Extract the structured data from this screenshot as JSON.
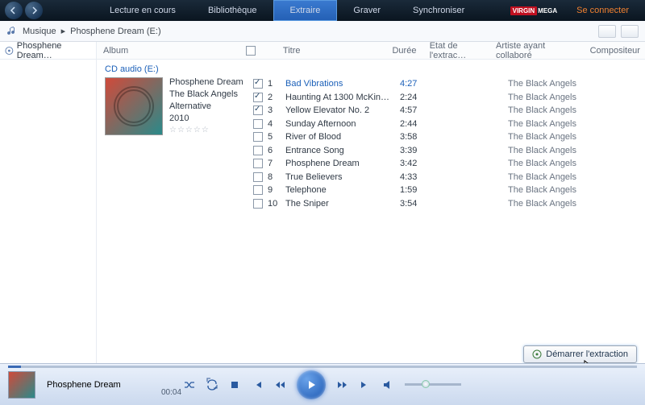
{
  "topbar": {
    "tabs": [
      "Lecture en cours",
      "Bibliothèque",
      "Extraire",
      "Graver",
      "Synchroniser"
    ],
    "active_tab_index": 2,
    "shop": "VIRGINMEGA",
    "login": "Se connecter"
  },
  "breadcrumb": {
    "items": [
      "Musique",
      "Phosphene Dream (E:)"
    ]
  },
  "sidebar": {
    "label": "Phosphene Dream…"
  },
  "columns": {
    "album": "Album",
    "title": "Titre",
    "duration": "Durée",
    "status": "État de l'extrac…",
    "artist": "Artiste ayant collaboré",
    "composer": "Compositeur"
  },
  "cd_label": "CD audio (E:)",
  "album": {
    "name": "Phosphene Dream",
    "artist": "The Black Angels",
    "genre": "Alternative",
    "year": "2010"
  },
  "tracks": [
    {
      "n": "1",
      "title": "Bad Vibrations",
      "dur": "4:27",
      "artist": "The Black Angels",
      "checked": true,
      "playing": true
    },
    {
      "n": "2",
      "title": "Haunting At 1300 McKin…",
      "dur": "2:24",
      "artist": "The Black Angels",
      "checked": true,
      "playing": false
    },
    {
      "n": "3",
      "title": "Yellow Elevator No. 2",
      "dur": "4:57",
      "artist": "The Black Angels",
      "checked": true,
      "playing": false
    },
    {
      "n": "4",
      "title": "Sunday Afternoon",
      "dur": "2:44",
      "artist": "The Black Angels",
      "checked": false,
      "playing": false
    },
    {
      "n": "5",
      "title": "River of Blood",
      "dur": "3:58",
      "artist": "The Black Angels",
      "checked": false,
      "playing": false
    },
    {
      "n": "6",
      "title": "Entrance Song",
      "dur": "3:39",
      "artist": "The Black Angels",
      "checked": false,
      "playing": false
    },
    {
      "n": "7",
      "title": "Phosphene Dream",
      "dur": "3:42",
      "artist": "The Black Angels",
      "checked": false,
      "playing": false
    },
    {
      "n": "8",
      "title": "True Believers",
      "dur": "4:33",
      "artist": "The Black Angels",
      "checked": false,
      "playing": false
    },
    {
      "n": "9",
      "title": "Telephone",
      "dur": "1:59",
      "artist": "The Black Angels",
      "checked": false,
      "playing": false
    },
    {
      "n": "10",
      "title": "The Sniper",
      "dur": "3:54",
      "artist": "The Black Angels",
      "checked": false,
      "playing": false
    }
  ],
  "action_button": "Démarrer l'extraction",
  "player": {
    "now_playing": "Phosphene Dream",
    "time": "00:04"
  }
}
